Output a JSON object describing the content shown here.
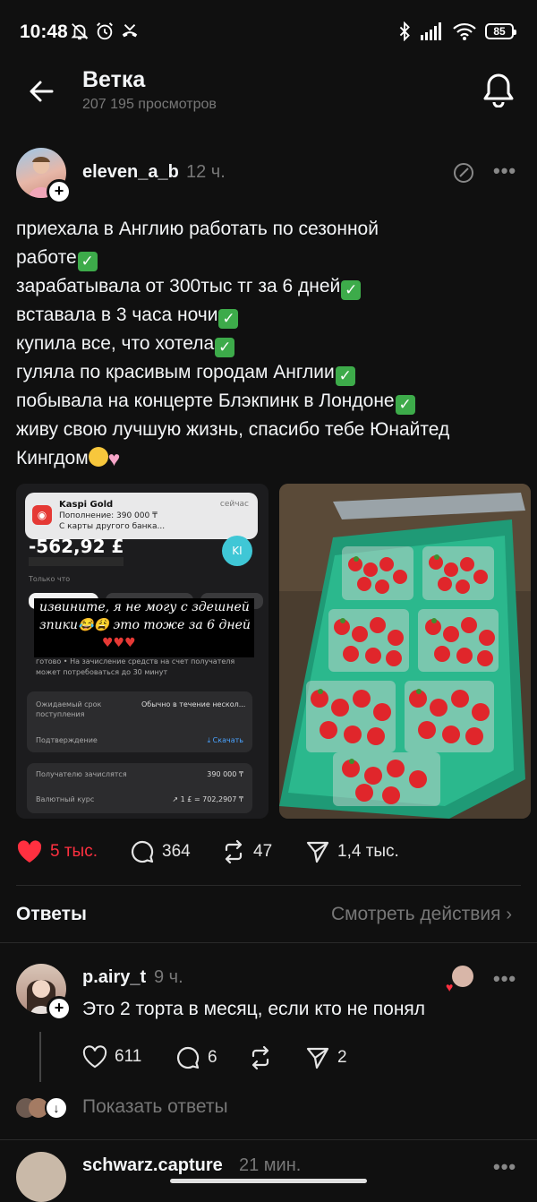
{
  "status_bar": {
    "time": "10:48",
    "battery": "85"
  },
  "header": {
    "title": "Ветка",
    "views": "207 195 просмотров"
  },
  "post": {
    "username": "eleven_a_b",
    "time": "12 ч.",
    "lines": [
      "приехала в Англию работать по сезонной",
      "работе",
      "зарабатывала от 300тыс тг за 6 дней",
      "вставала в 3 часа ночи",
      "купила все, что хотела",
      "гуляла по красивым городам Англии",
      "побывала на концерте Блэкпинк в Лондоне",
      "живу свою лучшую жизнь, спасибо тебе Юнайтед",
      "Кингдом"
    ],
    "screenshot": {
      "notif_title": "Kaspi Gold",
      "notif_time": "сейчас",
      "notif_line1": "Пополнение: 390 000 ₸",
      "notif_line2": "С карты другого банка...",
      "amount": "-562,92 £",
      "avatar_initials": "KI",
      "small_label": "Только что",
      "caption_line1": "извините, я не могу с здешней",
      "caption_line2": "зпики😂😩 это тоже за 6 дней",
      "info_text1": "готово • На зачисление средств на счет получателя",
      "info_text2": "может потребоваться до 30 минут",
      "row1_label": "Ожидаемый срок",
      "row1_label2": "поступления",
      "row1_value": "Обычно в течение нескол...",
      "row2_label": "Подтверждение",
      "row2_value": "Скачать",
      "row3_label": "Получателю зачислятся",
      "row3_value": "390 000 ₸",
      "row4_label": "Валютный курс",
      "row4_value": "1 £ = 702,2907 ₸"
    },
    "likes": "5 тыс.",
    "comments": "364",
    "reposts": "47",
    "shares": "1,4 тыс."
  },
  "replies_section": {
    "title": "Ответы",
    "link": "Смотреть действия"
  },
  "reply": {
    "username": "p.airy_t",
    "time": "9 ч.",
    "text": "Это 2 торта в месяц, если кто не понял",
    "likes": "611",
    "comments": "6",
    "shares": "2",
    "show_replies": "Показать ответы"
  },
  "next_reply": {
    "username": "schwarz.capture",
    "time": "21 мин."
  },
  "colors": {
    "background": "#101010",
    "like_red": "#ff3040",
    "muted": "#777777"
  }
}
